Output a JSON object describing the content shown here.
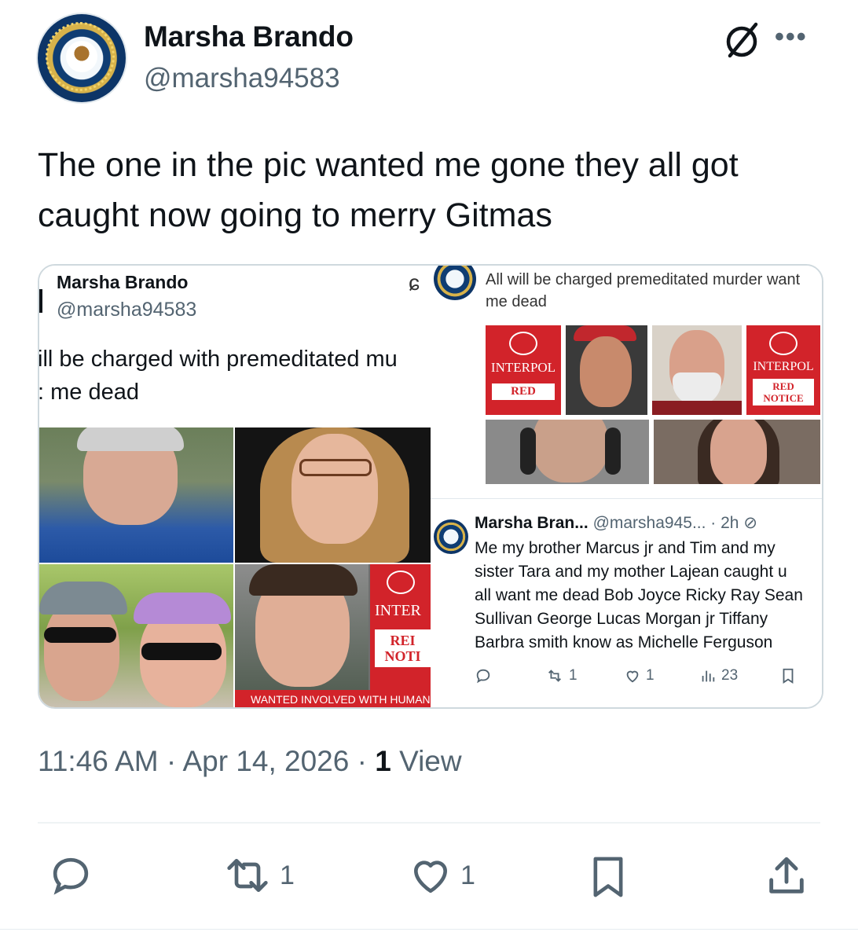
{
  "author": {
    "name": "Marsha Brando",
    "handle": "@marsha94583"
  },
  "tweet": {
    "text": "The one in the pic wanted me gone they all got caught now going to merry Gitmas",
    "time": "11:46 AM",
    "date": "Apr 14, 2026",
    "views_count": "1",
    "views_label": "View"
  },
  "media_left": {
    "name": "Marsha Brando",
    "handle": "@marsha94583",
    "text_line1": "ill be charged with premeditated mu",
    "text_line2": ": me dead",
    "interpol_label": "INTER",
    "red_notice_1": "REI",
    "red_notice_2": "NOTI",
    "wanted_caption": "WANTED  INVOLVED WITH HUMAN"
  },
  "media_right": {
    "text": "All will be charged premeditated murder want me dead",
    "interpol_label_1": "INTERPOL",
    "interpol_label_2": "INTERPOL",
    "red_label": "RED",
    "red_notice_a": "RED",
    "red_notice_b": "NOTICE",
    "quote": {
      "name": "Marsha Bran...",
      "handle": "@marsha945...",
      "age": "· 2h",
      "line1": "Me my brother Marcus jr and Tim and my",
      "line2": "sister Tara and my mother Lajean caught u",
      "line3": "all want me dead Bob Joyce Ricky Ray Sean",
      "line4": "Sullivan George Lucas Morgan jr Tiffany",
      "line5": "Barbra smith know as Michelle Ferguson",
      "retweets": "1",
      "likes": "1",
      "views": "23"
    }
  },
  "actions": {
    "reply_count": "",
    "retweet_count": "1",
    "like_count": "1"
  },
  "icons": {
    "grok": "grok-slash-circle-icon",
    "more": "more-dots-icon",
    "reply": "reply-bubble-icon",
    "retweet": "retweet-arrows-icon",
    "like": "heart-icon",
    "bookmark": "bookmark-icon",
    "share": "share-upload-icon"
  },
  "colors": {
    "secondary_text": "#536471",
    "interpol_red": "#d2232a",
    "border": "#cfd9de"
  }
}
